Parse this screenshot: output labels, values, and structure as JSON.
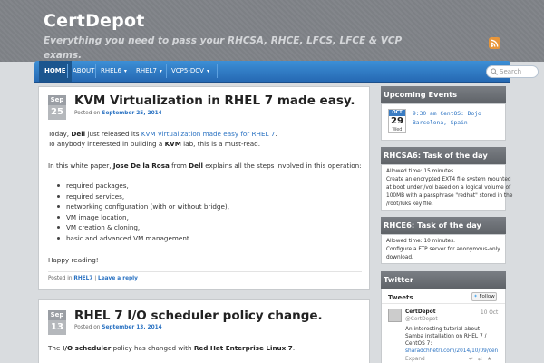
{
  "site": {
    "title": "CertDepot",
    "tagline": "Everything you need to pass your RHCSA, RHCE, LFCS, LFCE & VCP exams."
  },
  "nav": {
    "items": [
      {
        "label": "HOME",
        "active": true,
        "dropdown": false
      },
      {
        "label": "ABOUT",
        "active": false,
        "dropdown": false
      },
      {
        "label": "RHEL6",
        "active": false,
        "dropdown": true
      },
      {
        "label": "RHEL7",
        "active": false,
        "dropdown": true
      },
      {
        "label": "VCP5-DCV",
        "active": false,
        "dropdown": true
      }
    ],
    "search_placeholder": "Search"
  },
  "posts": [
    {
      "month": "Sep",
      "day": "25",
      "title": "KVM Virtualization in RHEL 7 made easy.",
      "posted_prefix": "Posted on",
      "date": "September 25, 2014",
      "p1_a": "Today,",
      "p1_b": "Dell",
      "p1_c": "just released its",
      "p1_link": "KVM Virtualization made easy for RHEL 7",
      "p1_end": ".",
      "p2_a": "To anybody interested in building a",
      "p2_b": "KVM",
      "p2_c": "lab, this is a must-read.",
      "p3_a": "In this white paper,",
      "p3_b": "Jose De la Rosa",
      "p3_c": "from",
      "p3_d": "Dell",
      "p3_e": "explains all the steps involved in this operation:",
      "bullets": [
        "required packages,",
        "required services,",
        "networking configuration (with or without bridge),",
        "VM image location,",
        "VM creation & cloning,",
        "basic and advanced VM management."
      ],
      "closing": "Happy reading!",
      "posted_in": "Posted in",
      "category": "RHEL7",
      "sep": "|",
      "reply": "Leave a reply"
    },
    {
      "month": "Sep",
      "day": "13",
      "title": "RHEL 7 I/O scheduler policy change.",
      "posted_prefix": "Posted on",
      "date": "September 13, 2014",
      "p1_a": "The",
      "p1_b": "I/O scheduler",
      "p1_c": "policy has changed with",
      "p1_d": "Red Hat Enterprise Linux 7",
      "p1_end": "."
    }
  ],
  "sidebar": {
    "events": {
      "heading": "Upcoming Events",
      "month": "OCT",
      "day": "29",
      "weekday": "Wed",
      "line1": "9:30 am CentOS: Dojo",
      "line2": "Barcelona, Spain"
    },
    "rhcsa": {
      "heading": "RHCSA6: Task of the day",
      "lines": [
        "Allowed time: 15 minutes.",
        "Create an encrypted EXT4 file system mounted",
        "at boot under /vol based on a logical volume of",
        "100MB with a passphrase \"redhat\" stored in the",
        "/root/luks key file."
      ]
    },
    "rhce": {
      "heading": "RHCE6: Task of the day",
      "lines": [
        "Allowed time: 10 minutes.",
        "Configure a FTP server for anonymous-only",
        "download."
      ]
    },
    "twitter": {
      "heading": "Twitter",
      "tweets_label": "Tweets",
      "follow_label": "Follow",
      "author": "CertDepot",
      "handle": "@CertDepot",
      "date": "10 Oct",
      "lines": [
        "An interesting tutorial about",
        "Samba installation on RHEL 7 /",
        "CentOS 7:",
        "sharadchhetri.com/2014/10/09/cen"
      ],
      "expand": "Expand"
    }
  },
  "colors": {
    "nav_blue": "#2a72c2",
    "header_gray": "#7d8085",
    "link": "#2a72c2"
  }
}
